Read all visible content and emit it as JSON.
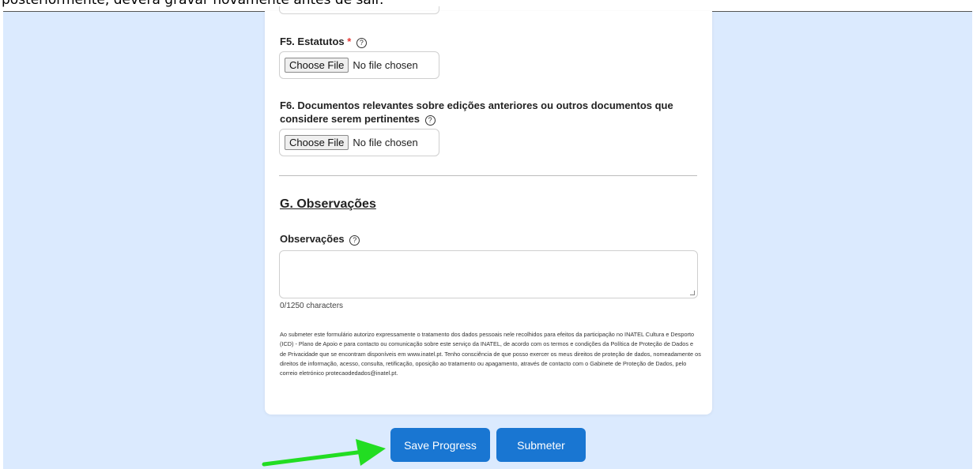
{
  "top_note": "posteriormente, deverá gravar novamente antes de sair.",
  "colors": {
    "accent": "#1976d2",
    "page_bg": "#dbeafe",
    "required": "#e53935",
    "arrow": "#22dd22"
  },
  "fields": {
    "f5": {
      "label": "F5. Estatutos",
      "required_mark": "*",
      "choose_label": "Choose File",
      "status": "No file chosen"
    },
    "f6": {
      "label": "F6. Documentos relevantes sobre edições anteriores ou outros documentos que considere serem pertinentes",
      "choose_label": "Choose File",
      "status": "No file chosen"
    }
  },
  "help_glyph": "?",
  "section_g": {
    "title": "G. Observações",
    "observacoes_label": "Observações",
    "observacoes_value": "",
    "char_count": "0/1250 characters"
  },
  "consent_text": "Ao submeter este formulário autorizo expressamente o tratamento dos dados pessoais nele recolhidos para efeitos da participação no INATEL Cultura e Desporto (ICD) - Plano de Apoio e para contacto ou comunicação sobre este serviço da INATEL, de acordo com os termos e condições da Política de Proteção de Dados e de Privacidade que se encontram disponíveis em www.inatel.pt. Tenho consciência de que posso exercer os meus direitos de proteção de dados, nomeadamente os direitos de informação, acesso, consulta, retificação, oposição ao tratamento ou apagamento, através de contacto com o Gabinete de Proteção de Dados, pelo correio eletrónico protecaodedados@inatel.pt.",
  "actions": {
    "save_label": "Save Progress",
    "submit_label": "Submeter"
  },
  "annotation_icon": "green-arrow-icon"
}
